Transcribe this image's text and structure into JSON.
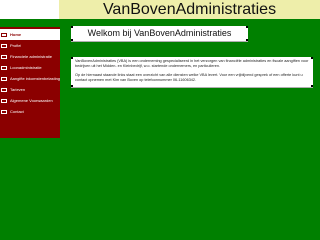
{
  "header": {
    "title": "VanBovenAdministraties"
  },
  "sidebar": {
    "items": [
      {
        "label": "Home",
        "active": true
      },
      {
        "label": "Profiel",
        "active": false
      },
      {
        "label": "Financiele administratie",
        "active": false
      },
      {
        "label": "Loonadministratie",
        "active": false
      },
      {
        "label": "Aangifte inkomstenbelasting",
        "active": false
      },
      {
        "label": "Tarieven",
        "active": false
      },
      {
        "label": "Algemene Voorwaarden",
        "active": false
      },
      {
        "label": "Contact",
        "active": false
      }
    ]
  },
  "main": {
    "welcome_title": "Welkom bij VanBovenAdministraties",
    "paragraphs": [
      "VanBovenAdministraties (VBA) is een onderneming gespecialiseerd in het verzorgen van financiële administraties en fiscale aangiften voor bedrijven uit het Midden- en Kleinbedrijf, w.o. startende ondernemers, en particulieren.",
      "Op de hiernaast staande links staat een overzicht van alle diensten welke VBA levert. Voor een vrijblijvend gesprek of een offerte kunt u contact opnemen met  Kim van Boven op telefoonnummer 06-11606342."
    ]
  },
  "colors": {
    "background": "#008000",
    "header": "#eeeeaa",
    "sidebar": "#8b0000",
    "panel": "#ffffff"
  }
}
